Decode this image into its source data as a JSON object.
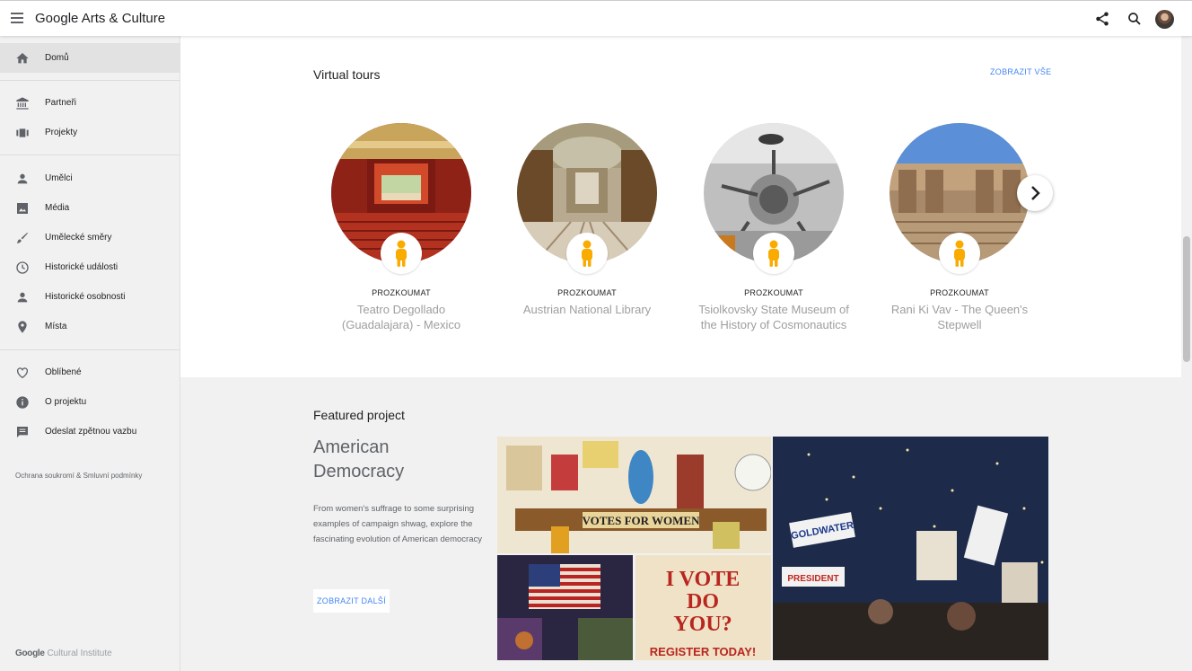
{
  "header": {
    "logo_text": "Google Arts & Culture"
  },
  "sidebar": {
    "items": [
      {
        "label": "Domů",
        "icon": "home-icon"
      },
      {
        "label": "Partneři",
        "icon": "museum-icon"
      },
      {
        "label": "Projekty",
        "icon": "projects-icon"
      },
      {
        "label": "Umělci",
        "icon": "person-icon"
      },
      {
        "label": "Média",
        "icon": "image-icon"
      },
      {
        "label": "Umělecké směry",
        "icon": "brush-icon"
      },
      {
        "label": "Historické události",
        "icon": "clock-icon"
      },
      {
        "label": "Historické osobnosti",
        "icon": "person-icon"
      },
      {
        "label": "Místa",
        "icon": "pin-icon"
      },
      {
        "label": "Oblíbené",
        "icon": "heart-icon"
      },
      {
        "label": "O projektu",
        "icon": "info-icon"
      },
      {
        "label": "Odeslat zpětnou vazbu",
        "icon": "feedback-icon"
      }
    ],
    "legal": "Ochrana soukromí & Smluvní podmínky",
    "footer_brand": "Google",
    "footer_product": "Cultural Institute"
  },
  "virtual_tours": {
    "title": "Virtual tours",
    "view_all": "ZOBRAZIT VŠE",
    "items": [
      {
        "kicker": "PROZKOUMAT",
        "title": "Teatro Degollado (Guadalajara) - Mexico"
      },
      {
        "kicker": "PROZKOUMAT",
        "title": "Austrian National Library"
      },
      {
        "kicker": "PROZKOUMAT",
        "title": "Tsiolkovsky State Museum of the History of Cosmonautics"
      },
      {
        "kicker": "PROZKOUMAT",
        "title": "Rani Ki Vav - The Queen's Stepwell"
      }
    ]
  },
  "featured": {
    "section_title": "Featured project",
    "title": "American Democracy",
    "description": "From women's suffrage to some surprising examples of campaign shwag, explore the fascinating evolution of American democracy",
    "button": "ZOBRAZIT DALŠÍ",
    "images": {
      "votes_banner": "VOTES FOR WOMEN",
      "poster_line1": "I VOTE",
      "poster_line2": "DO",
      "poster_line3": "YOU?",
      "poster_line4": "REGISTER TODAY!",
      "convention_sign1": "GOLDWATER",
      "convention_sign2": "PRESIDENT"
    }
  }
}
